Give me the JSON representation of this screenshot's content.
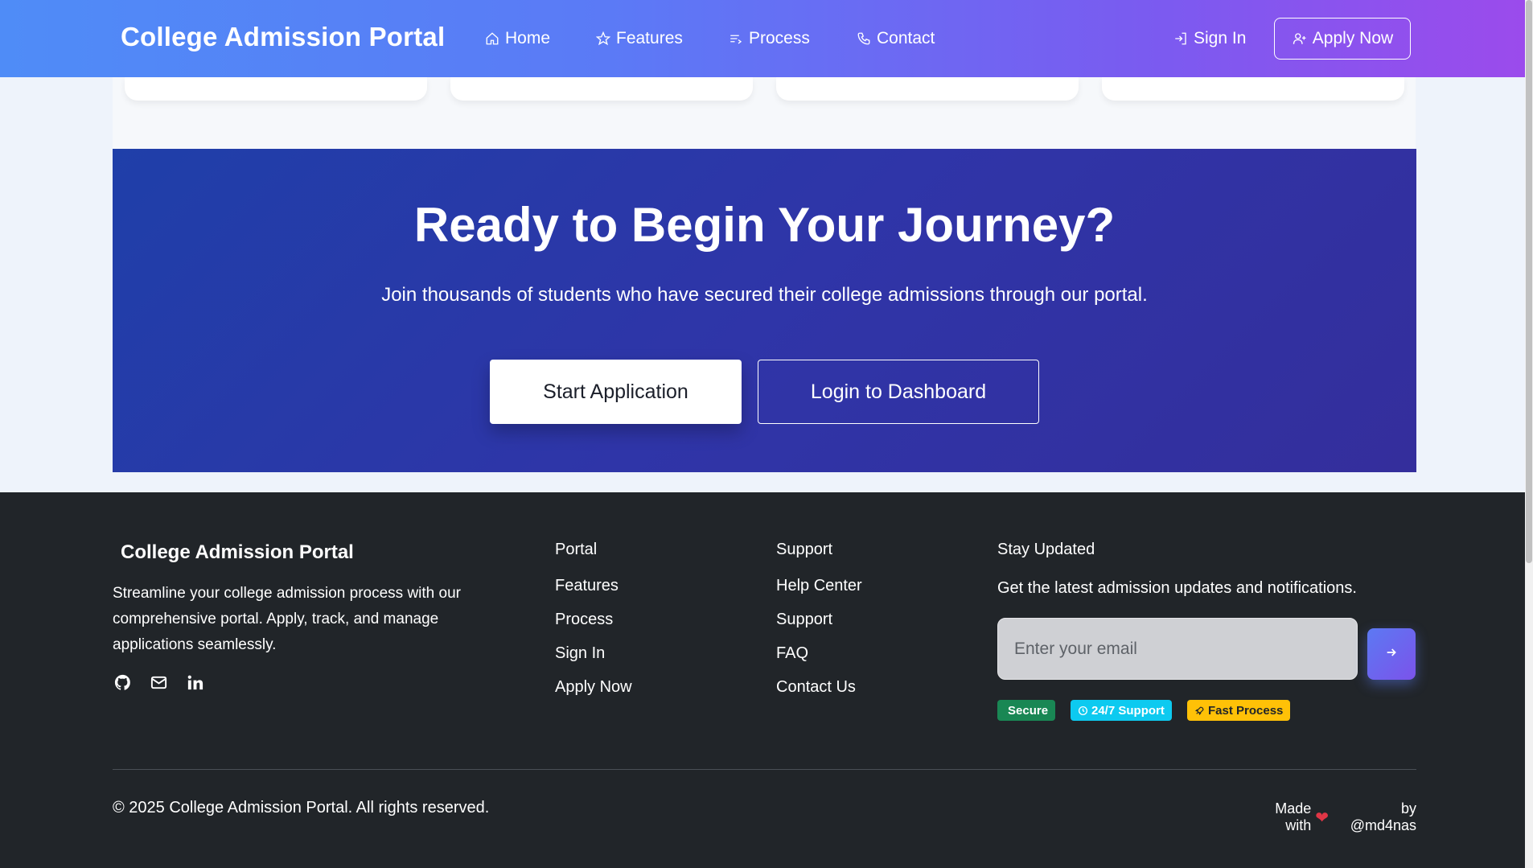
{
  "header": {
    "brand": "College Admission Portal",
    "nav": [
      {
        "label": "Home",
        "icon": "home-icon"
      },
      {
        "label": "Features",
        "icon": "star-icon"
      },
      {
        "label": "Process",
        "icon": "list-icon"
      },
      {
        "label": "Contact",
        "icon": "phone-icon"
      }
    ],
    "signin_label": "Sign In",
    "apply_label": "Apply Now"
  },
  "cta": {
    "title": "Ready to Begin Your Journey?",
    "subtitle": "Join thousands of students who have secured their college admissions through our portal.",
    "start_label": "Start Application",
    "login_label": "Login to Dashboard"
  },
  "footer": {
    "brand": "College Admission Portal",
    "description": "Streamline your college admission process with our comprehensive portal. Apply, track, and manage applications seamlessly.",
    "social": [
      "github-icon",
      "mail-icon",
      "linkedin-icon"
    ],
    "portal": {
      "heading": "Portal",
      "links": [
        "Features",
        "Process",
        "Sign In",
        "Apply Now"
      ]
    },
    "support": {
      "heading": "Support",
      "links": [
        "Help Center",
        "Support",
        "FAQ",
        "Contact Us"
      ]
    },
    "stay": {
      "heading": "Stay Updated",
      "text": "Get the latest admission updates and notifications.",
      "placeholder": "Enter your email"
    },
    "badges": [
      {
        "label": "Secure",
        "color": "#198754",
        "text_color": "#ffffff"
      },
      {
        "label": "24/7 Support",
        "color": "#0dcaf0",
        "text_color": "#ffffff"
      },
      {
        "label": "Fast Process",
        "color": "#ffc107",
        "text_color": "#212529"
      }
    ],
    "copyright": "© 2025 College Admission Portal. All rights reserved.",
    "made_prefix": "Made with",
    "made_suffix": "by @md4nas"
  },
  "colors": {
    "header_gradient_start": "#4f8cf7",
    "header_gradient_end": "#9b4bec",
    "cta_bg": "#2f35a8",
    "footer_bg": "#212529",
    "heart": "#e03646"
  }
}
